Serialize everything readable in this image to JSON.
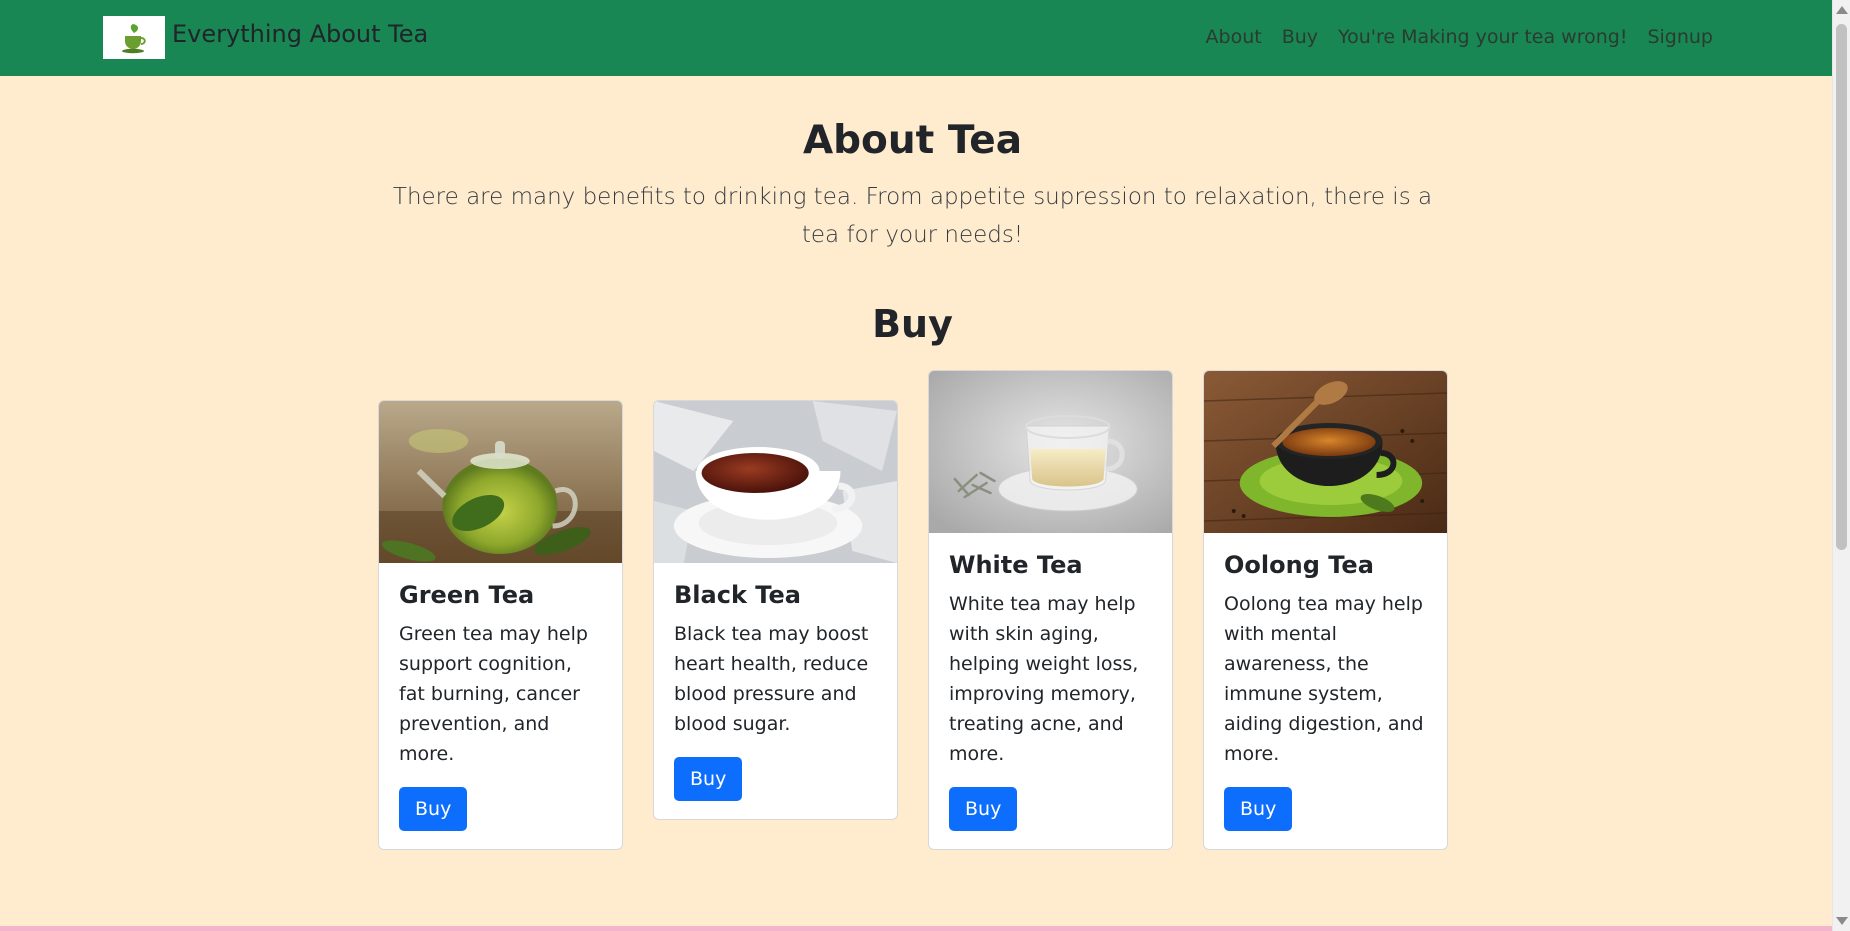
{
  "navbar": {
    "brand": "Everything About Tea",
    "brand_logo_icon": "teacup-icon",
    "links": [
      "About",
      "Buy",
      "You're Making your tea wrong!",
      "Signup"
    ],
    "bg_color": "#198754"
  },
  "hero": {
    "title": "About Tea",
    "subtitle": "There are many benefits to drinking tea. From appetite supression to relaxation, there is a tea for your needs!"
  },
  "buy_section": {
    "title": "Buy",
    "cards": [
      {
        "title": "Green Tea",
        "text": "Green tea may help support cognition, fat burning, cancer prevention, and more.",
        "button": "Buy",
        "image": "green-tea-teapot-image"
      },
      {
        "title": "Black Tea",
        "text": "Black tea may boost heart health, reduce blood pressure and blood sugar.",
        "button": "Buy",
        "image": "black-tea-cup-image"
      },
      {
        "title": "White Tea",
        "text": "White tea may help with skin aging, helping weight loss, improving memory, treating acne, and more.",
        "button": "Buy",
        "image": "white-tea-glass-cup-image"
      },
      {
        "title": "Oolong Tea",
        "text": "Oolong tea may help with mental awareness, the immune system, aiding digestion, and more.",
        "button": "Buy",
        "image": "oolong-tea-cup-image"
      }
    ]
  },
  "colors": {
    "page_bg": "#ffebcd",
    "button": "#0d6efd",
    "bottom_strip": "#f3b4cc"
  }
}
